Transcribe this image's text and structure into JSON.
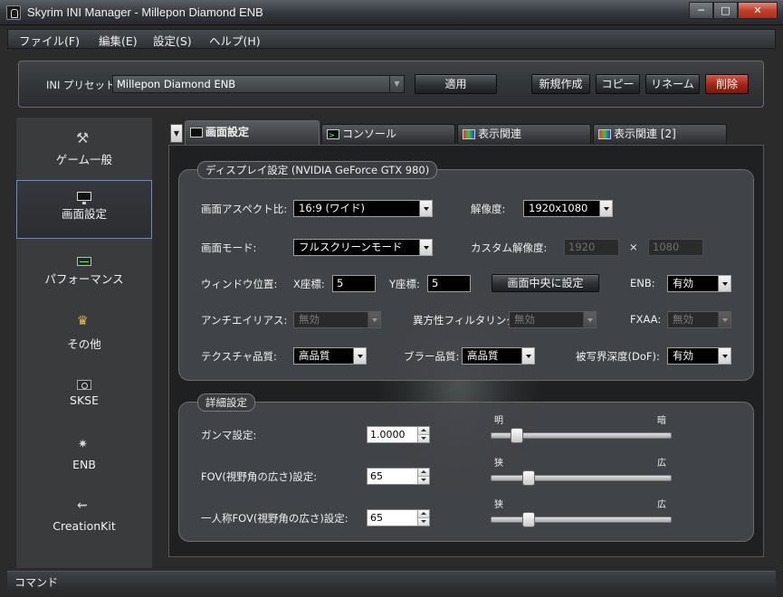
{
  "window": {
    "title": "Skyrim INI Manager - Millepon Diamond ENB",
    "minimize": "─",
    "maximize": "□",
    "close": "✕"
  },
  "menu": [
    "ファイル(F)",
    "編集(E)",
    "設定(S)",
    "ヘルプ(H)"
  ],
  "preset": {
    "label": "INI プリセット:",
    "value": "Millepon Diamond ENB",
    "apply": "適用",
    "new": "新規作成",
    "copy": "コピー",
    "rename": "リネーム",
    "delete": "削除"
  },
  "sidebar": [
    {
      "label": "ゲーム一般",
      "icon": "tools-icon"
    },
    {
      "label": "画面設定",
      "icon": "monitor-icon"
    },
    {
      "label": "パフォーマンス",
      "icon": "performance-icon"
    },
    {
      "label": "その他",
      "icon": "crown-icon"
    },
    {
      "label": "SKSE",
      "icon": "skse-icon"
    },
    {
      "label": "ENB",
      "icon": "enb-icon"
    },
    {
      "label": "CreationKit",
      "icon": "creationkit-icon"
    }
  ],
  "tabs": [
    "画面設定",
    "コンソール",
    "表示関連",
    "表示関連 [2]"
  ],
  "display": {
    "title": "ディスプレイ設定 (NVIDIA GeForce GTX 980)",
    "aspect_label": "画面アスペクト比:",
    "aspect_value": "16:9 (ワイド)",
    "resolution_label": "解像度:",
    "resolution_value": "1920x1080",
    "mode_label": "画面モード:",
    "mode_value": "フルスクリーンモード",
    "custom_res_label": "カスタム解像度:",
    "custom_w": "1920",
    "custom_x": "×",
    "custom_h": "1080",
    "window_pos_label": "ウィンドウ位置:",
    "x_label": "X座標:",
    "x_value": "5",
    "y_label": "Y座標:",
    "y_value": "5",
    "center_button": "画面中央に設定",
    "enb_label": "ENB:",
    "enb_value": "有効",
    "aa_label": "アンチエイリアス:",
    "aa_value": "無効",
    "af_label": "異方性フィルタリング:",
    "af_value": "無効",
    "fxaa_label": "FXAA:",
    "fxaa_value": "無効",
    "texture_label": "テクスチャ品質:",
    "texture_value": "高品質",
    "blur_label": "ブラー品質:",
    "blur_value": "高品質",
    "dof_label": "被写界深度(DoF):",
    "dof_value": "有効"
  },
  "detail": {
    "title": "詳細設定",
    "gamma_label": "ガンマ設定:",
    "gamma_value": "1.0000",
    "gamma_left": "明",
    "gamma_right": "暗",
    "gamma_level": 0.12,
    "fov_label": "FOV(視野角の広さ)設定:",
    "fov_value": "65",
    "fov_left": "狭",
    "fov_right": "広",
    "fov_level": 0.19,
    "fpfov_label": "一人称FOV(視野角の広さ)設定:",
    "fpfov_value": "65",
    "fpfov_left": "狭",
    "fpfov_right": "広",
    "fpfov_level": 0.19
  },
  "status": "コマンド"
}
